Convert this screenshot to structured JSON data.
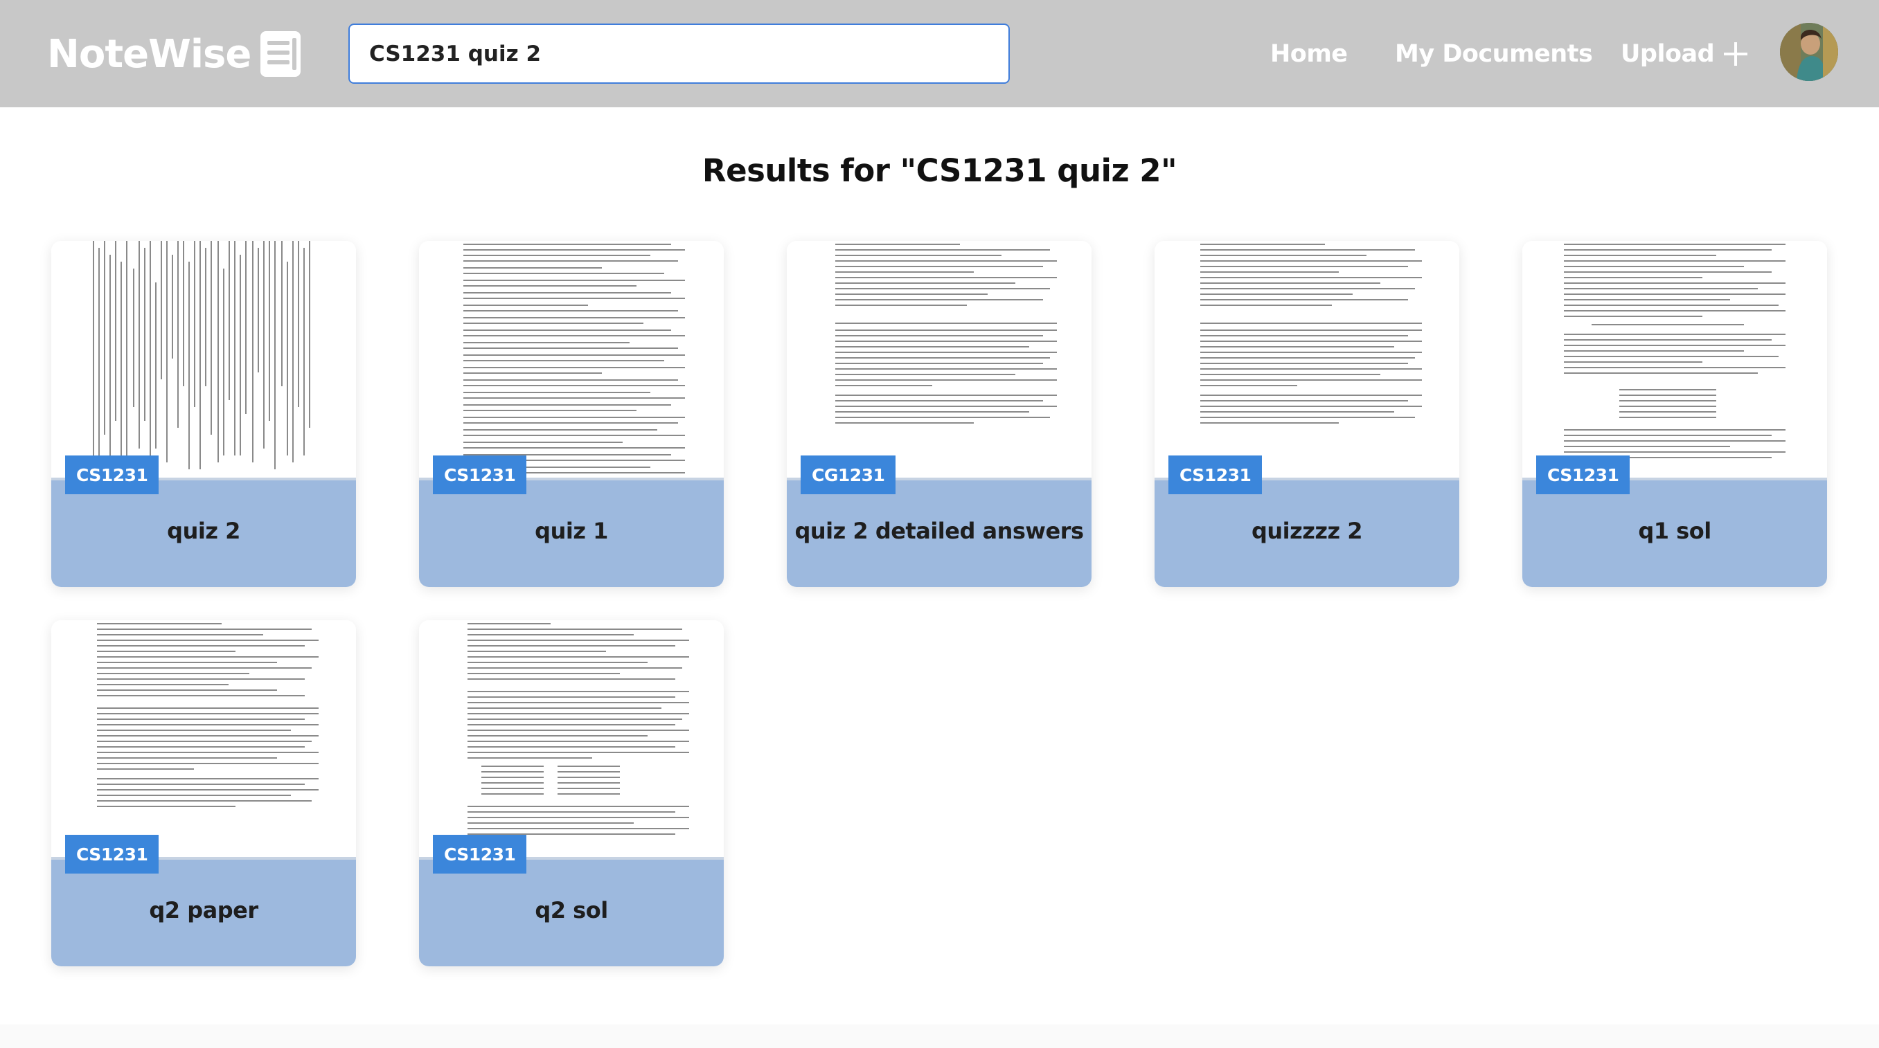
{
  "app": {
    "brand": "NoteWise",
    "brand_icon": "document-icon"
  },
  "search": {
    "value": "CS1231 quiz 2",
    "placeholder": ""
  },
  "nav": {
    "home": "Home",
    "my_documents": "My Documents",
    "upload": "Upload",
    "upload_icon": "plus-icon"
  },
  "results": {
    "title": "Results for \"CS1231 quiz 2\""
  },
  "cards": [
    {
      "badge": "CS1231",
      "title": "quiz 2"
    },
    {
      "badge": "CS1231",
      "title": "quiz 1"
    },
    {
      "badge": "CG1231",
      "title": "quiz 2 detailed answers"
    },
    {
      "badge": "CS1231",
      "title": "quizzzz 2"
    },
    {
      "badge": "CS1231",
      "title": "q1 sol"
    },
    {
      "badge": "CS1231",
      "title": "q2 paper"
    },
    {
      "badge": "CS1231",
      "title": "q2 sol"
    }
  ],
  "colors": {
    "header_bg": "#c8c8c8",
    "search_border": "#3f7ddb",
    "badge_bg": "#3b86db",
    "card_footer_bg": "#9db9de"
  }
}
